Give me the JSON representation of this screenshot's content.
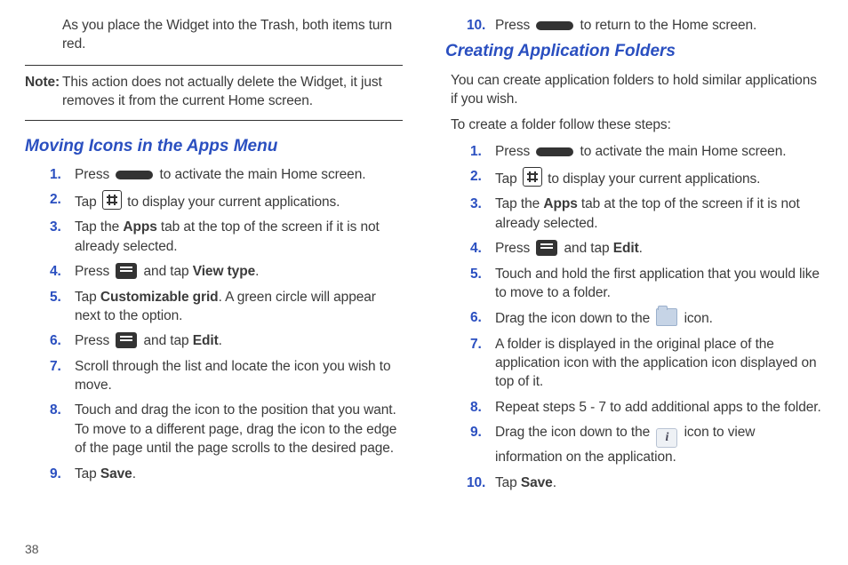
{
  "pageNumber": "38",
  "left": {
    "trashPara": "As you place the Widget into the Trash, both items turn red.",
    "noteLabel": "Note:",
    "noteText": "This action does not actually delete the Widget, it just removes it from the current Home screen.",
    "heading1": "Moving Icons in the Apps Menu",
    "s1a": "Press ",
    "s1b": " to activate the main Home screen.",
    "s2a": "Tap ",
    "s2b": " to display your current applications.",
    "s3a": "Tap the ",
    "s3b": "Apps",
    "s3c": " tab at the top of the screen if it is not already selected.",
    "s4a": "Press ",
    "s4b": " and tap ",
    "s4c": "View type",
    "s4d": ".",
    "s5a": "Tap ",
    "s5b": "Customizable grid",
    "s5c": ". A green circle will appear next to the option.",
    "s6a": "Press ",
    "s6b": " and tap ",
    "s6c": "Edit",
    "s6d": ".",
    "s7": "Scroll through the list and locate the icon you wish to move.",
    "s8": "Touch and drag the icon to the position that you want. To move to a different page, drag the icon to the edge of the page until the page scrolls to the desired page.",
    "s9a": "Tap ",
    "s9b": "Save",
    "s9c": "."
  },
  "right": {
    "s10num": "10.",
    "s10a": "Press ",
    "s10b": " to return to the Home screen.",
    "heading2": "Creating Application Folders",
    "intro1": "You can create application folders to hold similar applications if you wish.",
    "intro2": "To create a folder follow these steps:",
    "r1a": "Press ",
    "r1b": " to activate the main Home screen.",
    "r2a": "Tap ",
    "r2b": " to display your current applications.",
    "r3a": "Tap the ",
    "r3b": "Apps",
    "r3c": " tab at the top of the screen if it is not already selected.",
    "r4a": "Press ",
    "r4b": " and tap ",
    "r4c": "Edit",
    "r4d": ".",
    "r5": "Touch and hold the first application that you would like to move to a folder.",
    "r6a": "Drag the icon down to the ",
    "r6b": " icon.",
    "r7": "A folder is displayed in the original place of the application icon with the application icon displayed on top of it.",
    "r8": "Repeat steps 5 - 7 to add additional apps to the folder.",
    "r9a": "Drag the icon down to the ",
    "r9b": " icon to view information on the application.",
    "r10num": "10.",
    "r10a": "Tap ",
    "r10b": "Save",
    "r10c": "."
  },
  "icons": {
    "infoGlyph": "i"
  }
}
